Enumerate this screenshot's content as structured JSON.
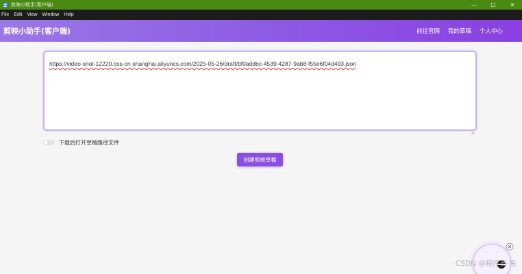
{
  "window": {
    "title": "剪映小助手(客户端)",
    "controls": {
      "minimize": "—",
      "maximize": "☐",
      "close": "✕"
    }
  },
  "menubar": {
    "items": [
      "File",
      "Edit",
      "View",
      "Window",
      "Help"
    ]
  },
  "header": {
    "brand": "剪映小助手(客户端)",
    "nav": [
      "前往官网",
      "我的草稿",
      "个人中心"
    ]
  },
  "main": {
    "url_value": "https://video-snot-12220.oss-cn-shanghai.aliyuncs.com/2025-05-26/draft/bf0addbc-4539-4287-9ab8-f55e6f04d493.json",
    "toggle_label": "下载后打开草稿路径文件",
    "toggle_on": false,
    "create_button": "创建剪映草稿"
  },
  "watermark": "CSDN @程序员·东",
  "colors": {
    "titlebar": "#4a8a12",
    "menubar": "#1c1c1c",
    "accent": "#8a4fe0",
    "header_start": "#9b77e6",
    "header_end": "#8a3fe2"
  },
  "icons": {
    "app": "app-logo-icon",
    "close_float": "close-circle-icon",
    "float": "assistant-bubble-icon"
  }
}
